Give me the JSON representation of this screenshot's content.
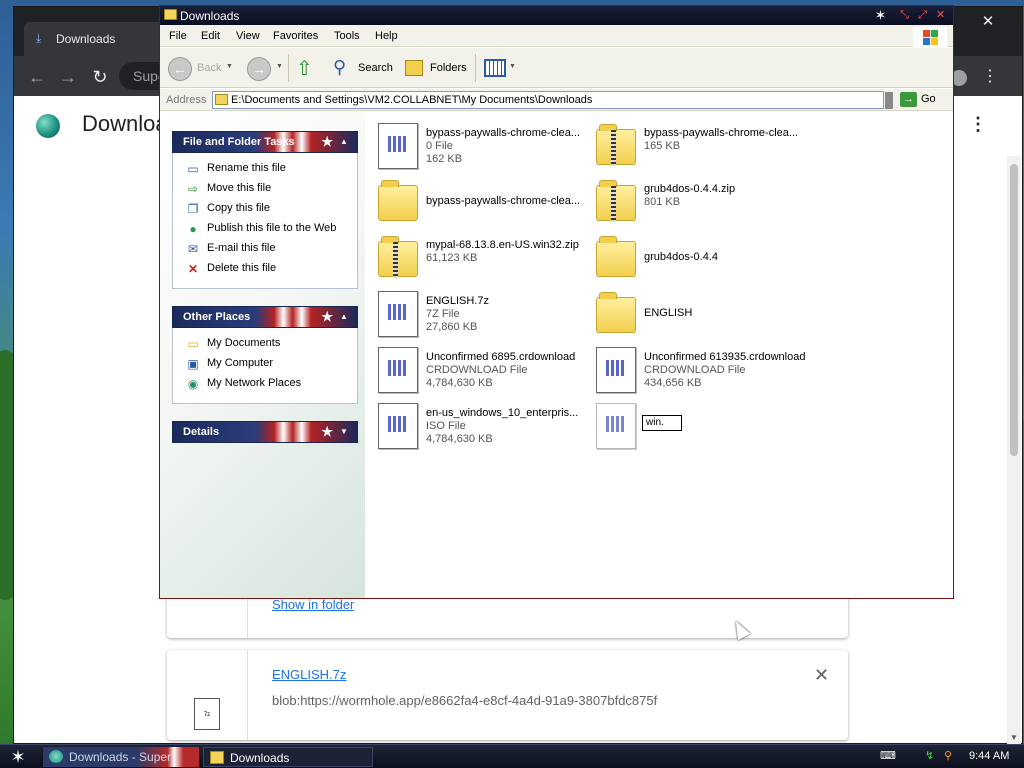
{
  "chrome": {
    "tab_title": "Downloads",
    "omnibox_text": "Supe",
    "page_title": "Downloa",
    "cards": [
      {
        "link": "Show in folder",
        "url": "",
        "close": ""
      },
      {
        "link": "ENGLISH.7z",
        "url": "blob:https://wormhole.app/e8662fa4-e8cf-4a4d-91a9-3807bfdc875f",
        "close": "✕",
        "file_icon_text": "7z"
      }
    ]
  },
  "explorer": {
    "title": "Downloads",
    "menu": [
      "File",
      "Edit",
      "View",
      "Favorites",
      "Tools",
      "Help"
    ],
    "toolbar": {
      "back": "Back",
      "search": "Search",
      "folders": "Folders"
    },
    "address_label": "Address",
    "address_value": "E:\\Documents and Settings\\VM2.COLLABNET\\My Documents\\Downloads",
    "go_label": "Go",
    "file_tasks": {
      "title": "File and Folder Tasks",
      "items": [
        "Rename this file",
        "Move this file",
        "Copy this file",
        "Publish this file to the Web",
        "E-mail this file",
        "Delete this file"
      ]
    },
    "other_places": {
      "title": "Other Places",
      "items": [
        "My Documents",
        "My Computer",
        "My Network Places"
      ]
    },
    "details": {
      "title": "Details"
    },
    "files": [
      {
        "name": "bypass-paywalls-chrome-clea...",
        "type": "0 File",
        "size": "162 KB",
        "icon": "document-icon"
      },
      {
        "name": "bypass-paywalls-chrome-clea...",
        "type": "",
        "size": "165 KB",
        "icon": "zip-folder-icon"
      },
      {
        "name": "bypass-paywalls-chrome-clea...",
        "type": "",
        "size": "",
        "icon": "folder-icon"
      },
      {
        "name": "grub4dos-0.4.4.zip",
        "type": "",
        "size": "801 KB",
        "icon": "zip-folder-icon"
      },
      {
        "name": "mypal-68.13.8.en-US.win32.zip",
        "type": "",
        "size": "61,123 KB",
        "icon": "zip-folder-icon"
      },
      {
        "name": "grub4dos-0.4.4",
        "type": "",
        "size": "",
        "icon": "folder-icon"
      },
      {
        "name": "ENGLISH.7z",
        "type": "7Z File",
        "size": "27,860 KB",
        "icon": "document-icon"
      },
      {
        "name": "ENGLISH",
        "type": "",
        "size": "",
        "icon": "folder-icon"
      },
      {
        "name": "Unconfirmed 6895.crdownload",
        "type": "CRDOWNLOAD File",
        "size": "4,784,630 KB",
        "icon": "document-icon"
      },
      {
        "name": "Unconfirmed 613935.crdownload",
        "type": "CRDOWNLOAD File",
        "size": "434,656 KB",
        "icon": "document-icon"
      },
      {
        "name": "en-us_windows_10_enterpris...",
        "type": "ISO File",
        "size": "4,784,630 KB",
        "icon": "document-icon"
      },
      {
        "name": "win.",
        "type": "",
        "size": "",
        "icon": "document-icon",
        "renaming": true
      }
    ]
  },
  "taskbar": {
    "chrome_button": "Downloads - Super",
    "explorer_button": "Downloads",
    "clock": "9:44 AM"
  }
}
